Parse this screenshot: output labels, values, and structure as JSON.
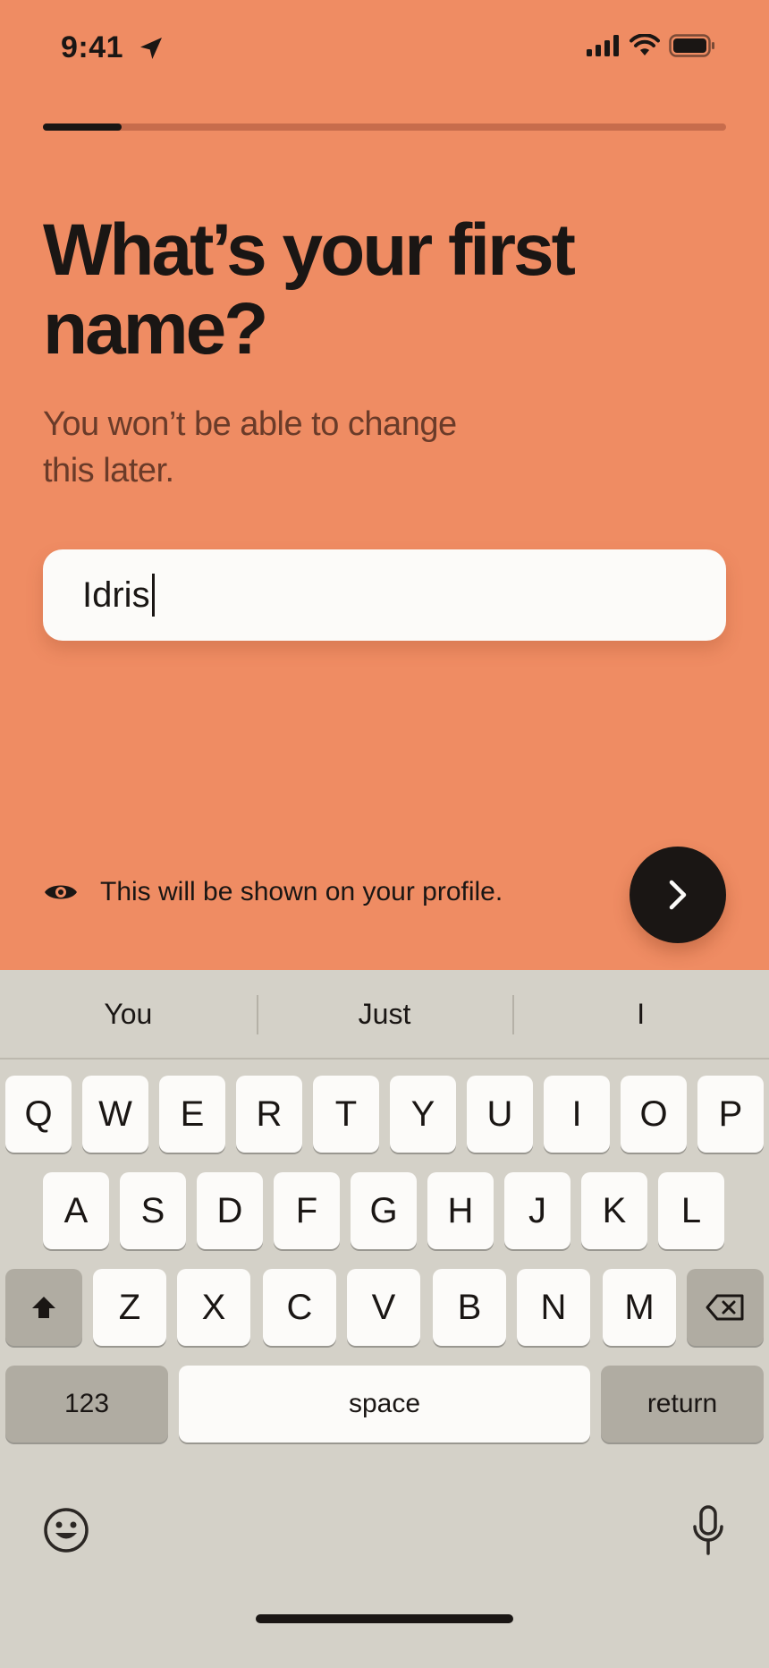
{
  "status_bar": {
    "time": "9:41"
  },
  "progress": {
    "fraction": 0.115
  },
  "content": {
    "title": "What’s your first name?",
    "subtitle": "You won’t be able to change this later.",
    "name_value": "Idris",
    "hint": "This will be shown on your profile."
  },
  "keyboard": {
    "suggestions": [
      "You",
      "Just",
      "I"
    ],
    "row1": [
      "Q",
      "W",
      "E",
      "R",
      "T",
      "Y",
      "U",
      "I",
      "O",
      "P"
    ],
    "row2": [
      "A",
      "S",
      "D",
      "F",
      "G",
      "H",
      "J",
      "K",
      "L"
    ],
    "row3": [
      "Z",
      "X",
      "C",
      "V",
      "B",
      "N",
      "M"
    ],
    "numbers_label": "123",
    "space_label": "space",
    "return_label": "return"
  },
  "icons": {
    "location": "location-arrow-icon",
    "signal": "signal-icon",
    "wifi": "wifi-icon",
    "battery": "battery-icon",
    "eye": "eye-icon",
    "next": "chevron-right-icon",
    "shift": "shift-icon",
    "delete": "backspace-icon",
    "emoji": "emoji-icon",
    "mic": "microphone-icon"
  },
  "colors": {
    "background": "#EF8C63",
    "text": "#1a1614",
    "keyboard": "#D4D1C8"
  }
}
